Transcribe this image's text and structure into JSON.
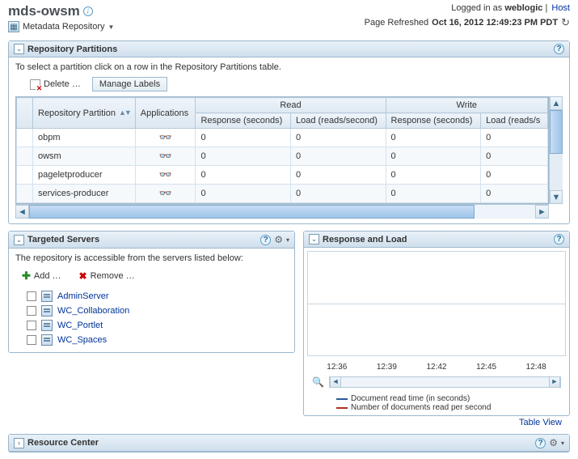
{
  "header": {
    "title": "mds-owsm",
    "menu_label": "Metadata Repository",
    "logged_in_prefix": "Logged in as ",
    "logged_in_user": "weblogic",
    "host_label": "Host",
    "refresh_prefix": "Page Refreshed ",
    "refresh_time": "Oct 16, 2012 12:49:23 PM PDT"
  },
  "partitions": {
    "panel_title": "Repository Partitions",
    "hint": "To select a partition click on a row in the Repository Partitions table.",
    "delete_label": "Delete …",
    "manage_label": "Manage Labels",
    "cols": {
      "partition": "Repository Partition",
      "applications": "Applications",
      "read": "Read",
      "write": "Write",
      "response": "Response (seconds)",
      "load_r": "Load (reads/second)",
      "load_w": "Load (reads/s"
    },
    "rows": [
      {
        "name": "obpm",
        "r_resp": "0",
        "r_load": "0",
        "w_resp": "0",
        "w_load": "0"
      },
      {
        "name": "owsm",
        "r_resp": "0",
        "r_load": "0",
        "w_resp": "0",
        "w_load": "0"
      },
      {
        "name": "pageletproducer",
        "r_resp": "0",
        "r_load": "0",
        "w_resp": "0",
        "w_load": "0"
      },
      {
        "name": "services-producer",
        "r_resp": "0",
        "r_load": "0",
        "w_resp": "0",
        "w_load": "0"
      }
    ]
  },
  "targeted": {
    "panel_title": "Targeted Servers",
    "hint": "The repository is accessible from the servers listed below:",
    "add_label": "Add …",
    "remove_label": "Remove …",
    "servers": [
      "AdminServer",
      "WC_Collaboration",
      "WC_Portlet",
      "WC_Spaces"
    ]
  },
  "response_load": {
    "panel_title": "Response and Load",
    "legend1": "Document read time (in seconds)",
    "legend2": "Number of documents read per second",
    "table_view": "Table View"
  },
  "chart_data": {
    "type": "line",
    "title": "Response and Load",
    "xlabel": "",
    "ylabel": "",
    "x_ticks": [
      "12:36",
      "12:39",
      "12:42",
      "12:45",
      "12:48"
    ],
    "series": [
      {
        "name": "Document read time (in seconds)",
        "color": "#2a5a9a",
        "values": []
      },
      {
        "name": "Number of documents read per second",
        "color": "#b03020",
        "values": []
      }
    ]
  },
  "resource": {
    "panel_title": "Resource Center"
  }
}
